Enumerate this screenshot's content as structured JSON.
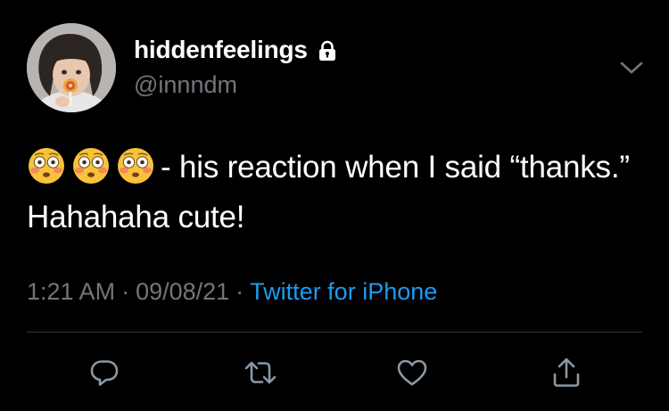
{
  "author": {
    "display_name": "hiddenfeelings",
    "handle": "@innndm",
    "protected_icon": "lock-icon",
    "avatar": "profile-photo"
  },
  "tweet": {
    "emojis": [
      "flushed-face-emoji",
      "flushed-face-emoji",
      "flushed-face-emoji"
    ],
    "text": "- his reaction when I said “thanks.” Hahahaha cute!"
  },
  "meta": {
    "time": "1:21 AM",
    "separator": "·",
    "date": "09/08/21",
    "source": "Twitter for iPhone"
  },
  "actions": [
    "reply-icon",
    "retweet-icon",
    "like-icon",
    "share-icon"
  ],
  "more_icon": "chevron-down-icon",
  "colors": {
    "background": "#000000",
    "primary_text": "#ffffff",
    "secondary_text": "#71767b",
    "link": "#1d9bf0",
    "divider": "#2f3336"
  }
}
